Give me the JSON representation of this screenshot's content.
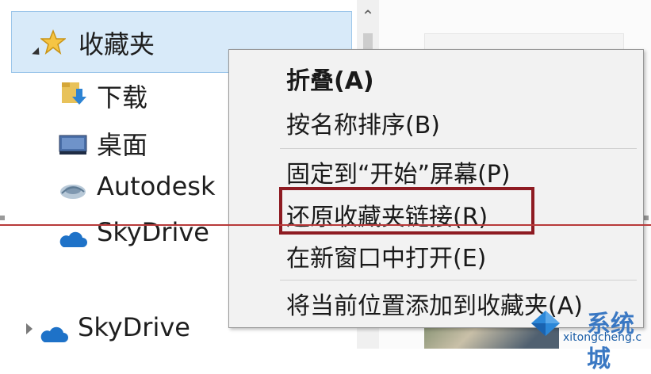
{
  "nav": {
    "favorites": "收藏夹",
    "downloads": "下载",
    "desktop": "桌面",
    "autodesk": "Autodesk",
    "skydrive_child": "SkyDrive",
    "skydrive_root": "SkyDrive"
  },
  "menu": {
    "items": [
      "折叠(A)",
      "按名称排序(B)",
      "固定到“开始”屏幕(P)",
      "还原收藏夹链接(R)",
      "在新窗口中打开(E)",
      "将当前位置添加到收藏夹(A)"
    ]
  },
  "watermark": {
    "brand": "系统城",
    "url": "xitongcheng.c"
  },
  "colors": {
    "selection": "#d8eaf9",
    "highlight_border": "#8e1b22",
    "accent_blue": "#1e72c8"
  }
}
